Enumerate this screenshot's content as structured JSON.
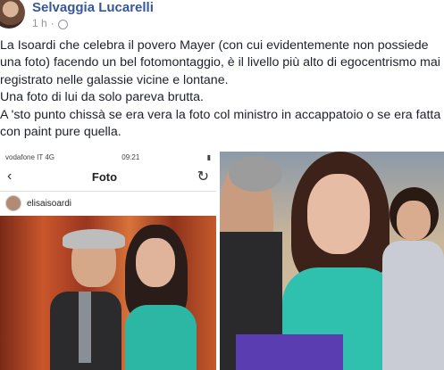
{
  "post": {
    "author": "Selvaggia Lucarelli",
    "time": "1 h",
    "separator": "·",
    "paragraphs": [
      "La Isoardi che celebra il povero Mayer (con cui evidentemente non possiede una foto) facendo un bel fotomontaggio, è il livello più alto di egocentrismo mai registrato nelle galassie vicine e lontane.",
      "Una foto di lui da solo pareva brutta.",
      "A 'sto punto chissà se era vera la foto col ministro in accappatoio o se era fatta con paint pure quella."
    ]
  },
  "screenshot": {
    "carrier": "vodafone IT  4G",
    "clock": "09:21",
    "nav_back": "‹",
    "nav_title": "Foto",
    "nav_refresh": "↻",
    "username": "elisaisoardi"
  },
  "icons": [
    "globe-icon",
    "back-icon",
    "refresh-icon"
  ]
}
